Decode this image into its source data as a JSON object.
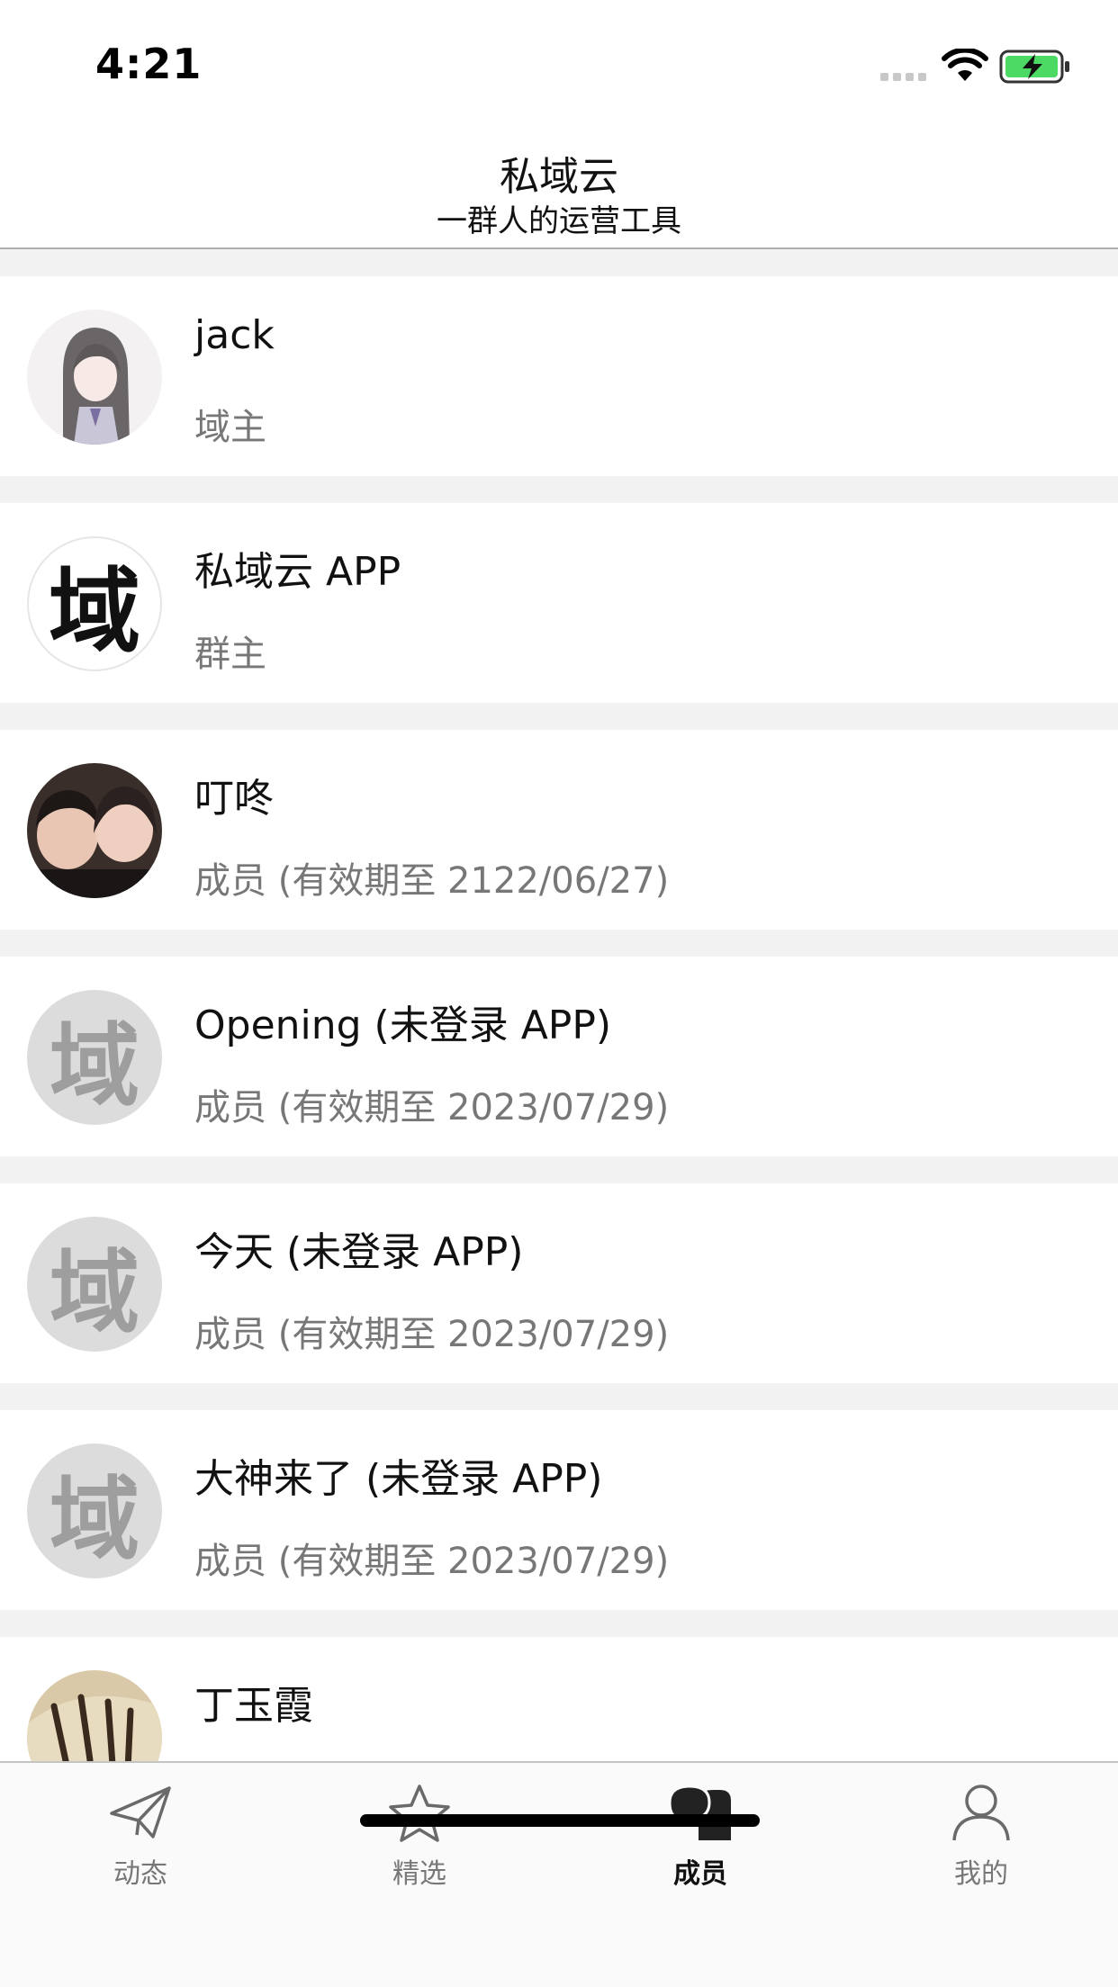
{
  "status_bar": {
    "time": "4:21"
  },
  "header": {
    "title": "私域云",
    "subtitle": "一群人的运营工具"
  },
  "members": [
    {
      "name": "jack",
      "role": "域主",
      "avatar": "photo-girl"
    },
    {
      "name": "私域云 APP",
      "role": "群主",
      "avatar": "app-logo",
      "avatar_glyph": "域"
    },
    {
      "name": "叮咚",
      "role": "成员 (有效期至 2122/06/27)",
      "avatar": "photo-kids"
    },
    {
      "name": "Opening (未登录 APP)",
      "role": "成员 (有效期至 2023/07/29)",
      "avatar": "default",
      "avatar_glyph": "域"
    },
    {
      "name": "今天 (未登录 APP)",
      "role": "成员 (有效期至 2023/07/29)",
      "avatar": "default",
      "avatar_glyph": "域"
    },
    {
      "name": "大神来了 (未登录 APP)",
      "role": "成员 (有效期至 2023/07/29)",
      "avatar": "default",
      "avatar_glyph": "域"
    },
    {
      "name": "丁玉霞",
      "role": "",
      "avatar": "photo-fan"
    }
  ],
  "tabs": [
    {
      "label": "动态",
      "icon": "paper-plane-icon",
      "active": false
    },
    {
      "label": "精选",
      "icon": "star-icon",
      "active": false
    },
    {
      "label": "成员",
      "icon": "chat-bubbles-icon",
      "active": true
    },
    {
      "label": "我的",
      "icon": "person-icon",
      "active": false
    }
  ],
  "colors": {
    "active_tab": "#111111",
    "inactive_tab": "#777777",
    "separator": "#f2f2f2"
  }
}
